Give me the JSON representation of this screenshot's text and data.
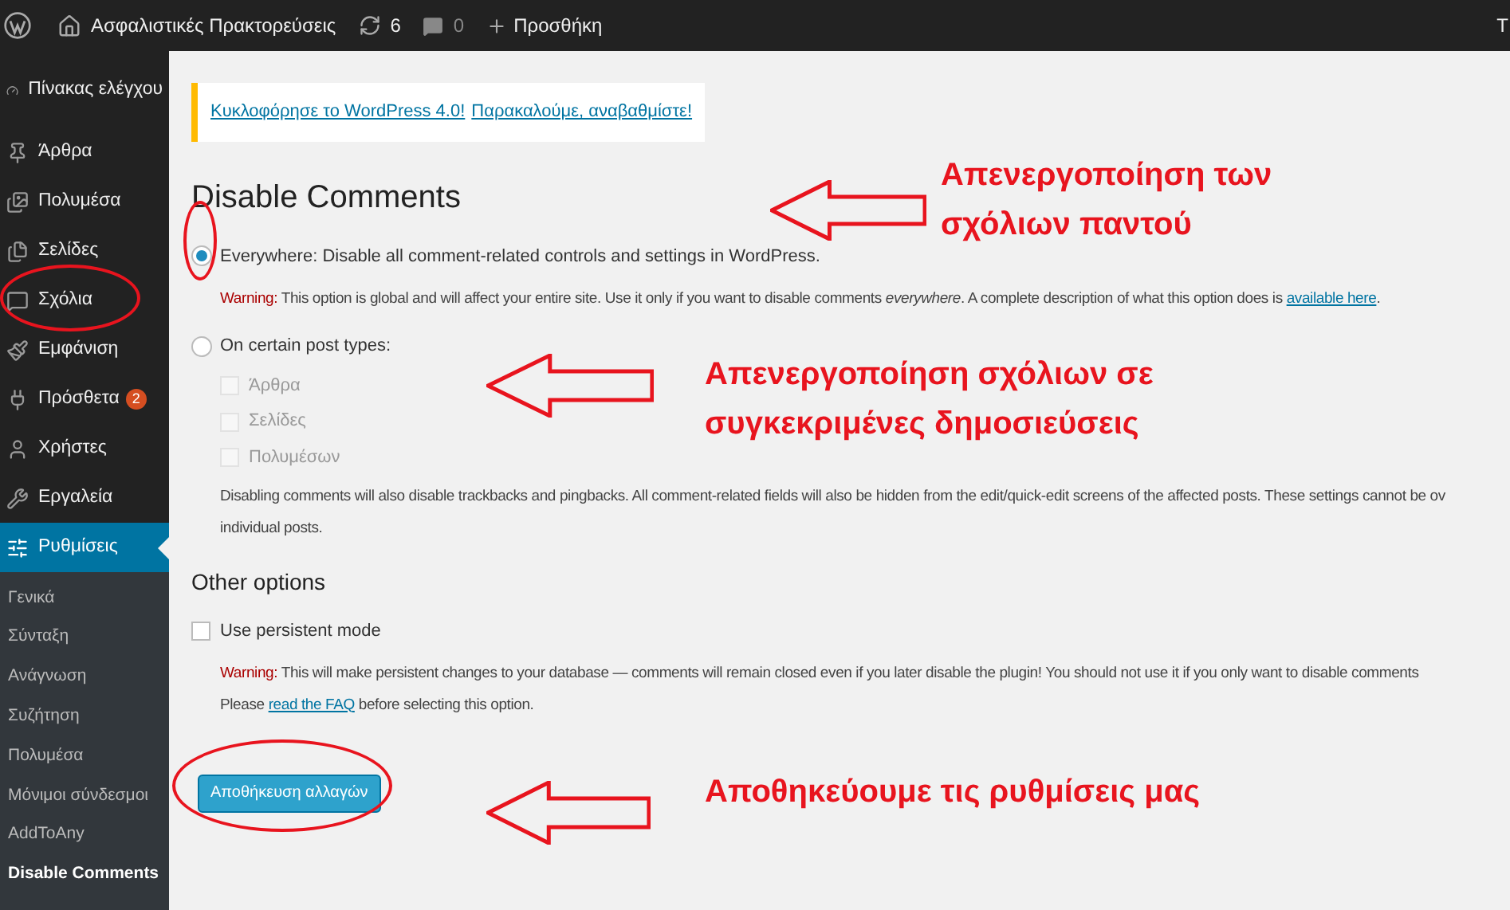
{
  "admin_bar": {
    "site_title": "Ασφαλιστικές Πρακτορεύσεις",
    "updates_count": "6",
    "comments_count": "0",
    "new_label": "Προσθήκη",
    "right_text": "Τ"
  },
  "sidebar": {
    "items": [
      {
        "label": "Πίνακας ελέγχου",
        "selected": false
      },
      {
        "label": "Άρθρα",
        "selected": false
      },
      {
        "label": "Πολυμέσα",
        "selected": false
      },
      {
        "label": "Σελίδες",
        "selected": false
      },
      {
        "label": "Σχόλια",
        "selected": false
      },
      {
        "label": "Εμφάνιση",
        "selected": false
      },
      {
        "label": "Πρόσθετα",
        "selected": false,
        "badge": "2"
      },
      {
        "label": "Χρήστες",
        "selected": false
      },
      {
        "label": "Εργαλεία",
        "selected": false
      },
      {
        "label": "Ρυθμίσεις",
        "selected": true
      }
    ],
    "submenu": [
      {
        "label": "Γενικά",
        "selected": false
      },
      {
        "label": "Σύνταξη",
        "selected": false
      },
      {
        "label": "Ανάγνωση",
        "selected": false
      },
      {
        "label": "Συζήτηση",
        "selected": false
      },
      {
        "label": "Πολυμέσα",
        "selected": false
      },
      {
        "label": "Μόνιμοι σύνδεσμοι",
        "selected": false
      },
      {
        "label": "AddToAny",
        "selected": false
      },
      {
        "label": "Disable Comments",
        "selected": true
      }
    ]
  },
  "notice": {
    "links": [
      "Κυκλοφόρησε το WordPress 4.0!",
      "Παρακαλούμε, αναβαθμίστε!"
    ]
  },
  "page_title": "Disable Comments",
  "everywhere": {
    "label": "Everywhere: Disable all comment-related controls and settings in WordPress.",
    "selected": true,
    "warning_label": "Warning:",
    "warning_text": "This option is global and will affect your entire site. Use it only if you want to disable comments *everywhere*. A complete description of what this option does is",
    "warning_link": "available here",
    "warning_end": "."
  },
  "post_types": {
    "label": "On certain post types:",
    "selected": false,
    "types": [
      {
        "label": "Άρθρα",
        "checked": false,
        "disabled": true
      },
      {
        "label": "Σελίδες",
        "checked": false,
        "disabled": true
      },
      {
        "label": "Πολυμέσων",
        "checked": false,
        "disabled": true
      }
    ],
    "note_lines": [
      "Disabling comments will also disable trackbacks and pingbacks. All comment-related fields will also be hidden from the edit/quick-edit screens of the affected posts. These settings cannot be ov",
      "individual posts."
    ]
  },
  "other_options": {
    "heading": "Other options",
    "persistent": {
      "label": "Use persistent mode",
      "checked": false
    },
    "warning_label": "Warning:",
    "warning_text": "This will make persistent changes to your database — comments will remain closed even if you later disable the plugin!",
    "warning_rest": "You should not use it if you only want to disable comments",
    "faq_before": "Please",
    "faq_link": "read the FAQ",
    "faq_after": "before selecting this option."
  },
  "save_button": "Αποθήκευση αλλαγών",
  "annotations": [
    {
      "text": "Απενεργοποίηση των σχόλιων παντού"
    },
    {
      "text": "Απενεργοποίηση σχόλιων σε συγκεκριμένες δημοσιεύσεις"
    },
    {
      "text": "Αποθηκεύουμε τις ρυθμίσεις μας"
    }
  ]
}
